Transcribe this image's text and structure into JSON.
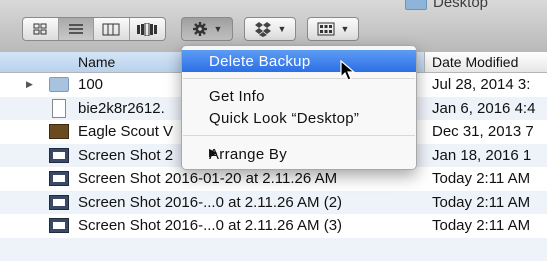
{
  "window": {
    "title": "Desktop"
  },
  "toolbar": {
    "view_buttons": [
      "icon-view",
      "list-view",
      "column-view",
      "coverflow-view"
    ],
    "active_view": "list-view"
  },
  "header": {
    "name": "Name",
    "date": "Date Modified"
  },
  "files": [
    {
      "name": "100",
      "date": "Jul 28, 2014 3:",
      "icon": "folder-icon",
      "disclosure": true
    },
    {
      "name": "bie2k8r2612.",
      "date": "Jan 6, 2016 4:4",
      "icon": "document-icon"
    },
    {
      "name": "Eagle Scout V",
      "date": "Dec 31, 2013 7",
      "icon": "movie-icon"
    },
    {
      "name": "Screen Shot 2",
      "date": "Jan 18, 2016 1",
      "icon": "screenshot-icon"
    },
    {
      "name": "Screen Shot 2016-01-20 at 2.11.26 AM",
      "date": "Today 2:11 AM",
      "icon": "screenshot-icon"
    },
    {
      "name": "Screen Shot 2016-...0 at 2.11.26 AM (2)",
      "date": "Today 2:11 AM",
      "icon": "screenshot-icon"
    },
    {
      "name": "Screen Shot 2016-...0 at 2.11.26 AM (3)",
      "date": "Today 2:11 AM",
      "icon": "screenshot-icon"
    },
    {
      "name": "",
      "date": "",
      "icon": ""
    }
  ],
  "menu": {
    "items": [
      {
        "label": "Delete Backup",
        "highlighted": true
      },
      {
        "label": "Get Info"
      },
      {
        "label": "Quick Look “Desktop”"
      },
      {
        "label": "Arrange By",
        "submenu": true
      }
    ]
  }
}
